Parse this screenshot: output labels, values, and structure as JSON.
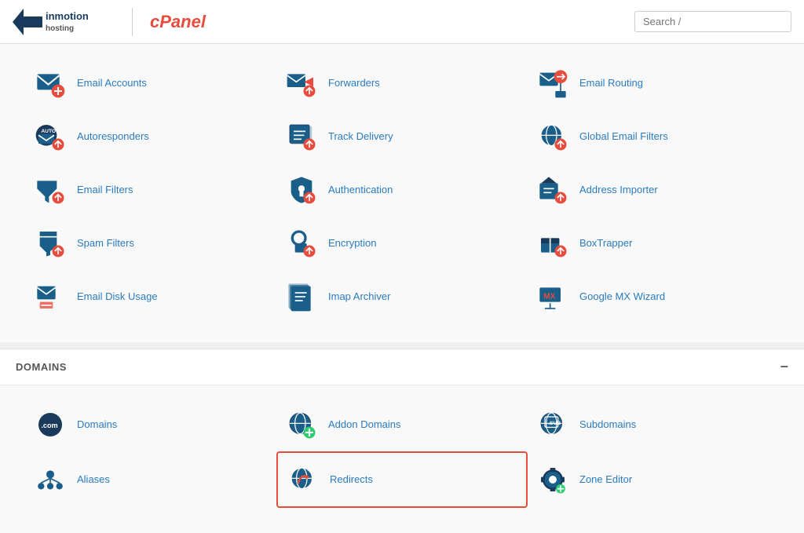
{
  "header": {
    "logo_brand": "inmotion",
    "logo_sub": "hosting",
    "cpanel_label": "cPanel",
    "search_placeholder": "Search /"
  },
  "email_items": [
    {
      "id": "email-accounts",
      "label": "Email Accounts",
      "icon": "email-accounts-icon"
    },
    {
      "id": "forwarders",
      "label": "Forwarders",
      "icon": "forwarders-icon"
    },
    {
      "id": "email-routing",
      "label": "Email Routing",
      "icon": "email-routing-icon"
    },
    {
      "id": "autoresponders",
      "label": "Autoresponders",
      "icon": "autoresponders-icon"
    },
    {
      "id": "track-delivery",
      "label": "Track Delivery",
      "icon": "track-delivery-icon"
    },
    {
      "id": "global-email-filters",
      "label": "Global Email Filters",
      "icon": "global-email-filters-icon"
    },
    {
      "id": "email-filters",
      "label": "Email Filters",
      "icon": "email-filters-icon"
    },
    {
      "id": "authentication",
      "label": "Authentication",
      "icon": "authentication-icon"
    },
    {
      "id": "address-importer",
      "label": "Address Importer",
      "icon": "address-importer-icon"
    },
    {
      "id": "spam-filters",
      "label": "Spam Filters",
      "icon": "spam-filters-icon"
    },
    {
      "id": "encryption",
      "label": "Encryption",
      "icon": "encryption-icon"
    },
    {
      "id": "boxtrapper",
      "label": "BoxTrapper",
      "icon": "boxtrapper-icon"
    },
    {
      "id": "email-disk-usage",
      "label": "Email Disk Usage",
      "icon": "email-disk-usage-icon"
    },
    {
      "id": "imap-archiver",
      "label": "Imap Archiver",
      "icon": "imap-archiver-icon"
    },
    {
      "id": "google-mx-wizard",
      "label": "Google MX Wizard",
      "icon": "google-mx-wizard-icon"
    }
  ],
  "domains_section": {
    "title": "DOMAINS",
    "collapse_symbol": "−",
    "items": [
      {
        "id": "domains",
        "label": "Domains",
        "icon": "domains-icon",
        "highlighted": false
      },
      {
        "id": "addon-domains",
        "label": "Addon Domains",
        "icon": "addon-domains-icon",
        "highlighted": false
      },
      {
        "id": "subdomains",
        "label": "Subdomains",
        "icon": "subdomains-icon",
        "highlighted": false
      },
      {
        "id": "aliases",
        "label": "Aliases",
        "icon": "aliases-icon",
        "highlighted": false
      },
      {
        "id": "redirects",
        "label": "Redirects",
        "icon": "redirects-icon",
        "highlighted": true
      },
      {
        "id": "zone-editor",
        "label": "Zone Editor",
        "icon": "zone-editor-icon",
        "highlighted": false
      }
    ]
  },
  "colors": {
    "accent_blue": "#2a7bbf",
    "accent_red": "#e74c3c",
    "icon_blue": "#1a5f8a",
    "background": "#f9f9f9",
    "highlight_border": "#e74c3c"
  }
}
